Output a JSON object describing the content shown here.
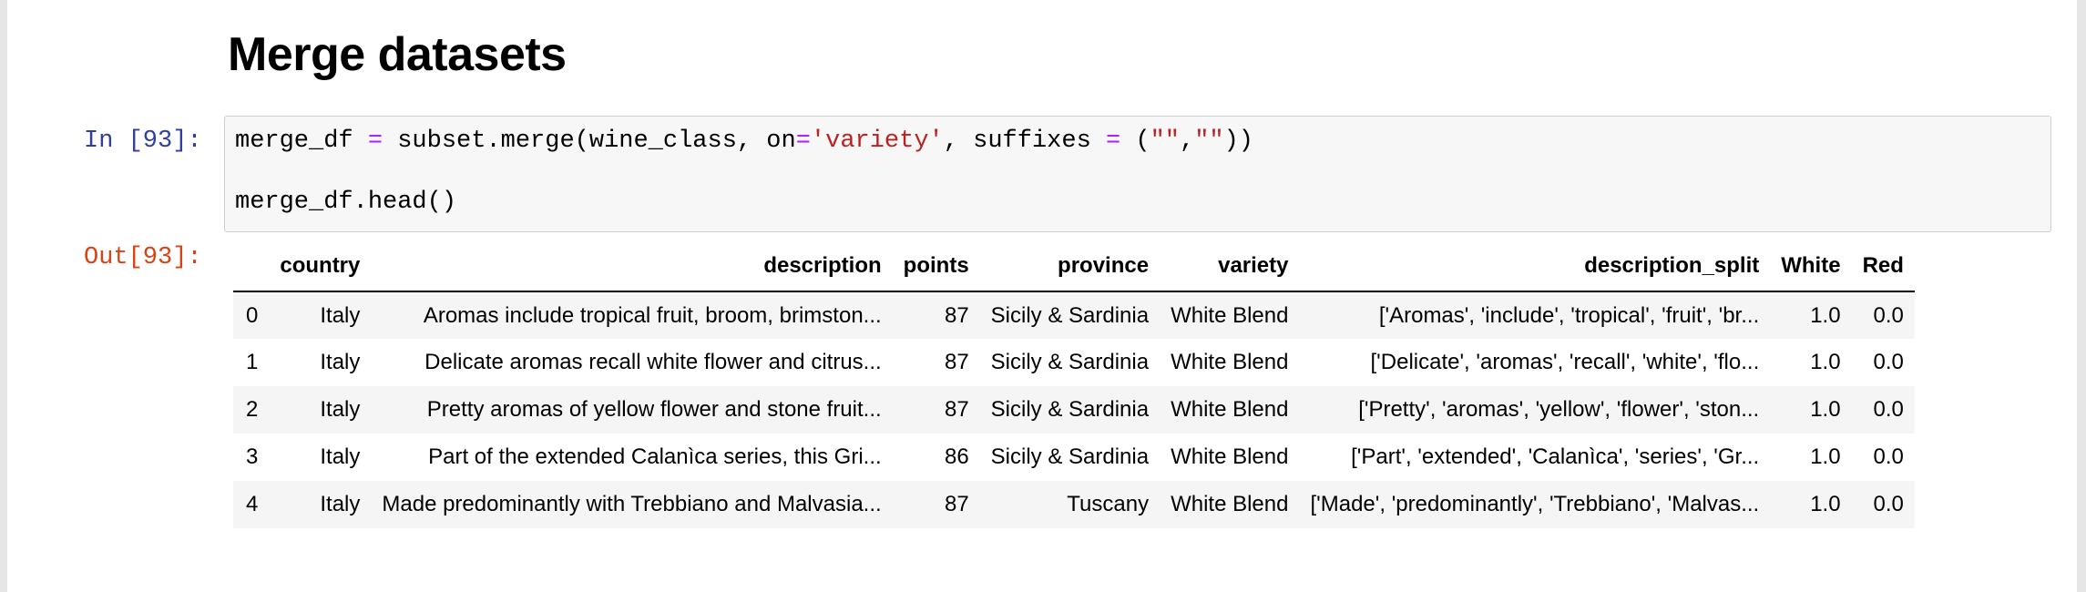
{
  "notebook": {
    "heading": "Merge datasets",
    "input_prompt": "In [93]:",
    "output_prompt": "Out[93]:",
    "code": {
      "line1_parts": [
        {
          "t": "merge_df ",
          "c": ""
        },
        {
          "t": "=",
          "c": "op"
        },
        {
          "t": " subset.merge(wine_class, on",
          "c": ""
        },
        {
          "t": "=",
          "c": "op"
        },
        {
          "t": "'variety'",
          "c": "str"
        },
        {
          "t": ", suffixes ",
          "c": ""
        },
        {
          "t": "=",
          "c": "op"
        },
        {
          "t": " (",
          "c": ""
        },
        {
          "t": "\"\"",
          "c": "str"
        },
        {
          "t": ",",
          "c": ""
        },
        {
          "t": "\"\"",
          "c": "str"
        },
        {
          "t": "))",
          "c": ""
        }
      ],
      "line2": "merge_df.head()"
    }
  },
  "dataframe": {
    "columns": [
      "",
      "country",
      "description",
      "points",
      "province",
      "variety",
      "description_split",
      "White",
      "Red"
    ],
    "rows": [
      [
        "0",
        "Italy",
        "Aromas include tropical fruit, broom, brimston...",
        "87",
        "Sicily & Sardinia",
        "White Blend",
        "['Aromas', 'include', 'tropical', 'fruit', 'br...",
        "1.0",
        "0.0"
      ],
      [
        "1",
        "Italy",
        "Delicate aromas recall white flower and citrus...",
        "87",
        "Sicily & Sardinia",
        "White Blend",
        "['Delicate', 'aromas', 'recall', 'white', 'flo...",
        "1.0",
        "0.0"
      ],
      [
        "2",
        "Italy",
        "Pretty aromas of yellow flower and stone fruit...",
        "87",
        "Sicily & Sardinia",
        "White Blend",
        "['Pretty', 'aromas', 'yellow', 'flower', 'ston...",
        "1.0",
        "0.0"
      ],
      [
        "3",
        "Italy",
        "Part of the extended Calanìca series, this Gri...",
        "86",
        "Sicily & Sardinia",
        "White Blend",
        "['Part', 'extended', 'Calanìca', 'series', 'Gr...",
        "1.0",
        "0.0"
      ],
      [
        "4",
        "Italy",
        "Made predominantly with Trebbiano and Malvasia...",
        "87",
        "Tuscany",
        "White Blend",
        "['Made', 'predominantly', 'Trebbiano', 'Malvas...",
        "1.0",
        "0.0"
      ]
    ]
  },
  "colors": {
    "input_prompt": "#303f9f",
    "output_prompt": "#d84315",
    "code_operator": "#aa22ff",
    "code_string": "#ba2121",
    "cell_background": "#f7f7f7",
    "row_stripe": "#f5f5f5"
  }
}
